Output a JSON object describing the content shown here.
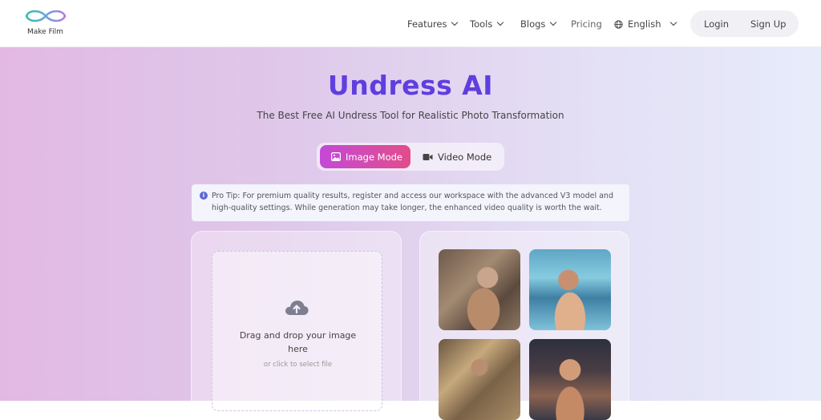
{
  "header": {
    "logo_text": "Make Film",
    "nav": {
      "features": "Features",
      "tools": "Tools",
      "blogs": "Blogs",
      "pricing": "Pricing",
      "language": "English"
    },
    "login": "Login",
    "signup": "Sign Up"
  },
  "hero": {
    "title": "Undress AI",
    "subtitle": "The Best Free AI Undress Tool for Realistic Photo Transformation",
    "modes": {
      "image": "Image Mode",
      "video": "Video Mode",
      "active": "image"
    },
    "tip": "Pro Tip: For premium quality results, register and access our workspace with the advanced V3 model and high-quality settings. While generation may take longer, the enhanced video quality is worth the wait."
  },
  "upload": {
    "title": "Drag and drop your image here",
    "subtitle": "or click to select file",
    "icon": "cloud-upload-icon"
  },
  "gallery": {
    "items": [
      "sample-image",
      "sample-image",
      "sample-image",
      "sample-image"
    ]
  },
  "colors": {
    "title": "#5f3ee0",
    "active_mode_start": "#c34ad7",
    "active_mode_end": "#e24c8a"
  }
}
